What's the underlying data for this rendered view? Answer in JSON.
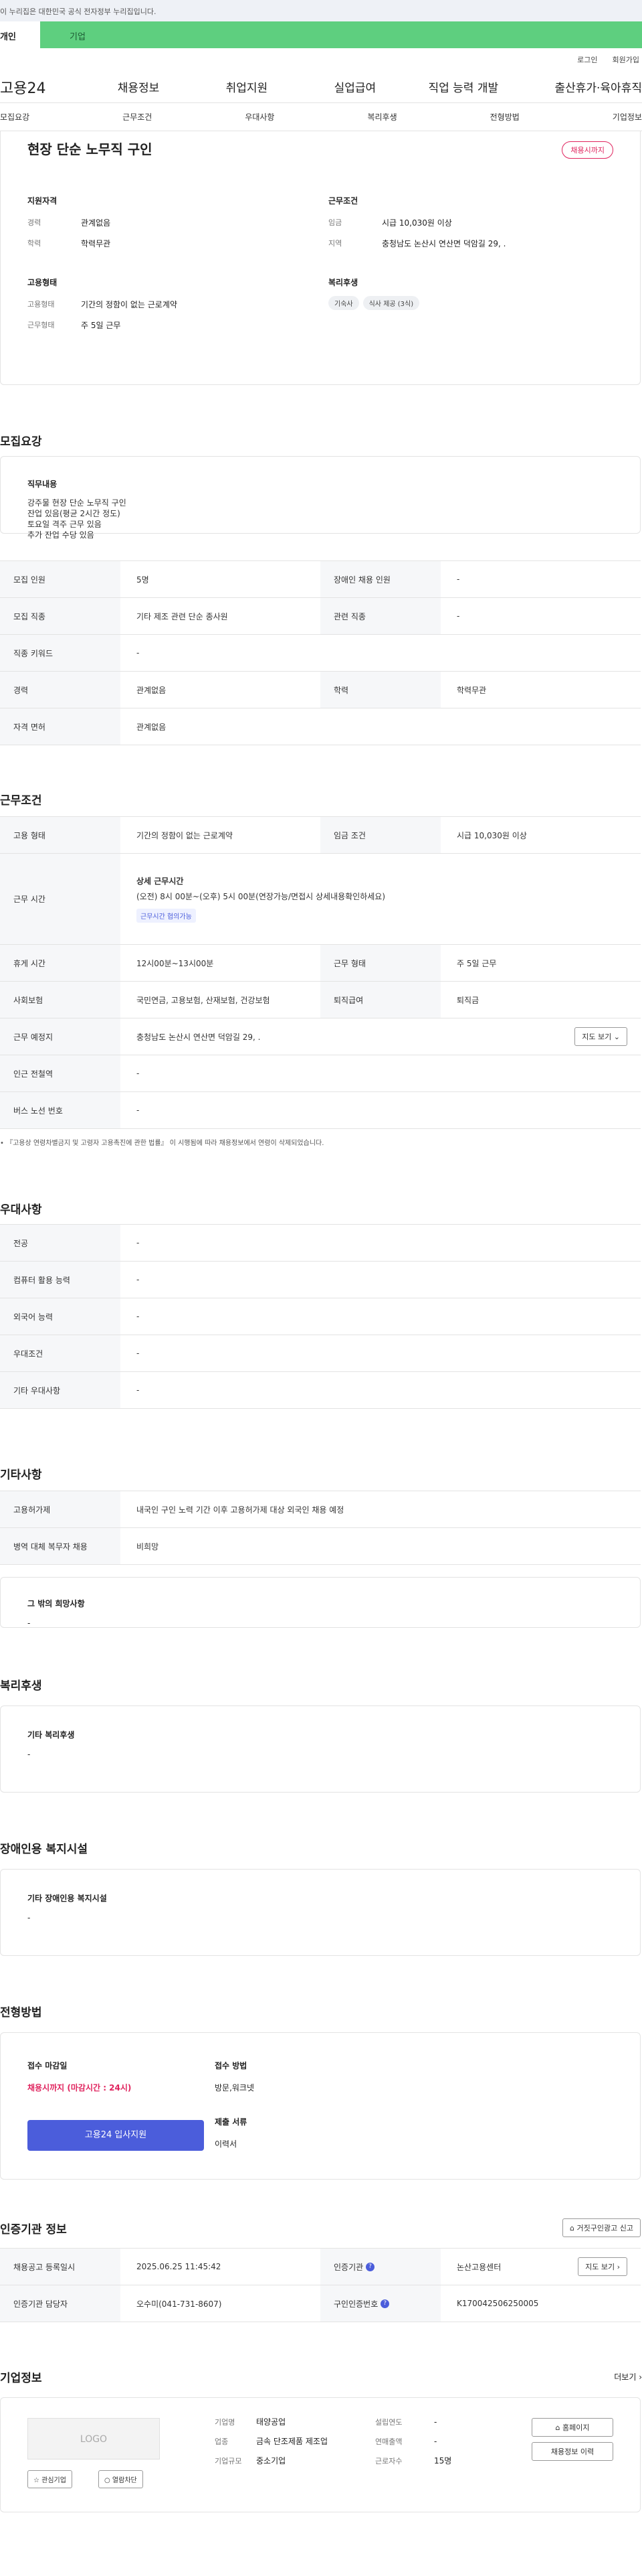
{
  "banner": {
    "text": "이 누리집은 대한민국 공식 전자정부 누리집입니다."
  },
  "switch": {
    "personal": "개인",
    "company": "기업"
  },
  "util": {
    "login": "로그인",
    "join": "회원가입"
  },
  "gnb": {
    "logo": "고용24",
    "items": [
      "채용정보",
      "취업지원",
      "실업급여",
      "직업 능력 개발",
      "출산휴가·육아휴직"
    ]
  },
  "lnb": [
    "모집요강",
    "근무조건",
    "우대사항",
    "복리후생",
    "전형방법",
    "기업정보"
  ],
  "job": {
    "title": "현장 단순 노무직 구인",
    "badge": "채용시까지",
    "qual_title": "지원자격",
    "career_label": "경력",
    "career": "관계없음",
    "edu_label": "학력",
    "edu": "학력무관",
    "emp_title": "고용형태",
    "emptype_label": "고용형태",
    "emptype": "기간의 정함이 없는 근로계약",
    "worktype_label": "근무형태",
    "worktype": "주 5일 근무",
    "cond_title": "근무조건",
    "wage_label": "임금",
    "wage": "시급 10,030원 이상",
    "region_label": "지역",
    "region": "충청남도 논산시 연산면 덕암길 29, .",
    "welfare_title": "복리후생",
    "welfare_tags": [
      "기숙사",
      "식사 제공 (3식)"
    ]
  },
  "recruit": {
    "title": "모집요강",
    "duty_title": "직무내용",
    "duty_lines": [
      "강주물 현장 단순 노무직 구인",
      "잔업 있음(평균 2시간 정도)",
      "토요일 격주 근무 있음",
      "추가 잔업 수당 있음"
    ],
    "rows": [
      {
        "k1": "모집 인원",
        "v1": "5명",
        "k2": "장애인 채용 인원",
        "v2": "-"
      },
      {
        "k1": "모집 직종",
        "v1": "기타 제조 관련 단순 종사원",
        "k2": "관련 직종",
        "v2": "-"
      },
      {
        "k1": "직종 키워드",
        "v1": "-"
      },
      {
        "k1": "경력",
        "v1": "관계없음",
        "k2": "학력",
        "v2": "학력무관"
      },
      {
        "k1": "자격 면허",
        "v1": "관계없음"
      }
    ]
  },
  "condition": {
    "title": "근무조건",
    "emptype_k": "고용 형태",
    "emptype_v": "기간의 정함이 없는 근로계약",
    "wage_k": "임금 조건",
    "wage_v": "시급 10,030원 이상",
    "hours_k": "근무 시간",
    "hours_title": "상세 근무시간",
    "hours_v": "(오전) 8시 00분~(오후) 5시 00분(연장가능/면접시 상세내용확인하세요)",
    "hours_tag": "근무시간 협의가능",
    "break_k": "휴게 시간",
    "break_v": "12시00분~13시00분",
    "worktype_k": "근무 형태",
    "worktype_v": "주 5일 근무",
    "ins_k": "사회보험",
    "ins_v": "국민연금, 고용보험, 산재보험, 건강보험",
    "sev_k": "퇴직급여",
    "sev_v": "퇴직금",
    "place_k": "근무 예정지",
    "place_v": "충청남도 논산시 연산면 덕암길 29, .",
    "map_btn": "지도 보기",
    "subway_k": "인근 전철역",
    "subway_v": "-",
    "bus_k": "버스 노선 번호",
    "bus_v": "-",
    "note": "『고용상 연령차별금지 및 고령자 고용촉진에 관한 법률』 이 시행됨에 따라 채용정보에서 연령이 삭제되었습니다."
  },
  "pref": {
    "title": "우대사항",
    "rows": [
      {
        "k": "전공",
        "v": "-"
      },
      {
        "k": "컴퓨터 활용 능력",
        "v": "-"
      },
      {
        "k": "외국어 능력",
        "v": "-"
      },
      {
        "k": "우대조건",
        "v": "-"
      },
      {
        "k": "기타 우대사항",
        "v": "-"
      }
    ]
  },
  "etc": {
    "title": "기타사항",
    "rows": [
      {
        "k": "고용허가제",
        "v": "내국인 구인 노력 기간 이후 고용허가제 대상 외국인 채용 예정"
      },
      {
        "k": "병역 대체 복무자 채용",
        "v": "비희망"
      }
    ],
    "box_title": "그 밖의 희망사항",
    "box_v": "-"
  },
  "welfare": {
    "title": "복리후생",
    "box_title": "기타 복리후생",
    "box_v": "-"
  },
  "disabled": {
    "title": "장애인용 복지시설",
    "box_title": "기타 장애인용 복지시설",
    "box_v": "-"
  },
  "selection": {
    "title": "전형방법",
    "deadline_title": "접수 마감일",
    "deadline_v": "채용시까지 (마감시간 : 24시)",
    "apply_btn": "고용24 입사지원",
    "method_title": "접수 방법",
    "method_v": "방문,워크넷",
    "docs_title": "제출 서류",
    "docs_v": "이력서"
  },
  "cert": {
    "title": "인증기관 정보",
    "report_btn": "거짓구인광고 신고",
    "reg_k": "채용공고 등록일시",
    "reg_v": "2025.06.25 11:45:42",
    "org_k": "인증기관",
    "org_v": "논산고용센터",
    "map_btn": "지도 보기",
    "mgr_k": "인증기관 담당자",
    "mgr_v": "오수미(041-731-8607)",
    "no_k": "구인인증번호",
    "no_v": "K170042506250005"
  },
  "company": {
    "title": "기업정보",
    "more": "더보기",
    "logo": "LOGO",
    "fav_btn": "관심기업",
    "block_btn": "열람차단",
    "name_k": "기업명",
    "name_v": "태양공업",
    "industry_k": "업종",
    "industry_v": "금속 단조제품 제조업",
    "scale_k": "기업규모",
    "scale_v": "중소기업",
    "est_k": "설립연도",
    "est_v": "-",
    "sales_k": "연매출액",
    "sales_v": "-",
    "emp_k": "근로자수",
    "emp_v": "15명",
    "home_btn": "홈페이지",
    "history_btn": "채용정보 이력"
  },
  "colors": {
    "green": "#5ecf7f",
    "blue": "#4b5ddb",
    "red": "#e0245e"
  }
}
